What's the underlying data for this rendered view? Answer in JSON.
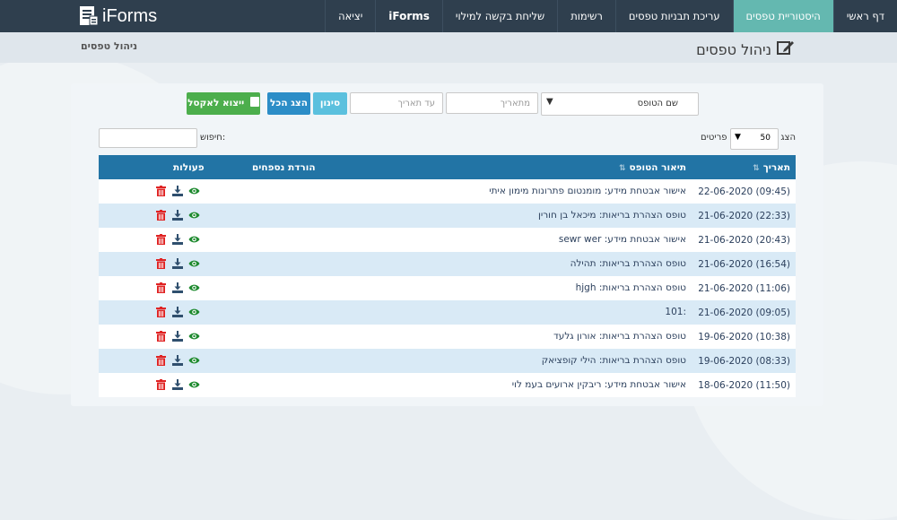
{
  "brand": {
    "name": "iForms"
  },
  "nav": {
    "items": [
      {
        "label": "דף ראשי",
        "active": false,
        "bold": false
      },
      {
        "label": "היסטוריית טפסים",
        "active": true,
        "bold": false
      },
      {
        "label": "עריכת תבניות טפסים",
        "active": false,
        "bold": false
      },
      {
        "label": "רשימות",
        "active": false,
        "bold": false
      },
      {
        "label": "שליחת בקשה למילוי",
        "active": false,
        "bold": false
      },
      {
        "label": "iForms",
        "active": false,
        "bold": true
      },
      {
        "label": "יציאה",
        "active": false,
        "bold": false
      }
    ]
  },
  "page": {
    "title": "ניהול טפסים",
    "breadcrumb": "ניהול טפסים"
  },
  "filters": {
    "form_select": "שם הטופס",
    "from_date_placeholder": "מתאריך",
    "to_date_placeholder": "עד תאריך",
    "filter_label": "סינון",
    "show_all_label": "הצג הכל",
    "export_label": "ייצוא לאקסל"
  },
  "table_controls": {
    "show_label": "הצג",
    "page_length": "50",
    "rows_label": "פריטים",
    "search_label": "חיפוש:"
  },
  "table": {
    "headers": {
      "date": "תאריך",
      "desc": "תיאור הטופס",
      "attachments": "הורדת נספחים",
      "actions": "פעולות"
    },
    "rows": [
      {
        "date": "22-06-2020 (09:45)",
        "desc": "אישור אבטחת מידע: מומנטום פתרונות מימון איתי"
      },
      {
        "date": "21-06-2020 (22:33)",
        "desc": "טופס הצהרת בריאות: מיכאל בן חורין"
      },
      {
        "date": "21-06-2020 (20:43)",
        "desc": "אישור אבטחת מידע: sewr wer"
      },
      {
        "date": "21-06-2020 (16:54)",
        "desc": "טופס הצהרת בריאות: תהילה"
      },
      {
        "date": "21-06-2020 (11:06)",
        "desc": "טופס הצהרת בריאות: hjgh"
      },
      {
        "date": "21-06-2020 (09:05)",
        "desc": ":101"
      },
      {
        "date": "19-06-2020 (10:38)",
        "desc": "טופס הצהרת בריאות: אורון גלעד"
      },
      {
        "date": "19-06-2020 (08:33)",
        "desc": "טופס הצהרת בריאות: הילי קופציאק"
      },
      {
        "date": "18-06-2020 (11:50)",
        "desc": "אישור אבטחת מידע: ריבקין ארועים בעמ לוי"
      }
    ]
  },
  "icons": {
    "view": "eye-icon",
    "download": "download-icon",
    "delete": "trash-icon"
  },
  "colors": {
    "navbar": "#2f3f4e",
    "active_tab": "#64b8b0",
    "table_header": "#2274a5",
    "row_alt": "#d9eaf6",
    "delete": "#e02424",
    "view": "#1e8a2f",
    "download": "#2f4f6e"
  }
}
